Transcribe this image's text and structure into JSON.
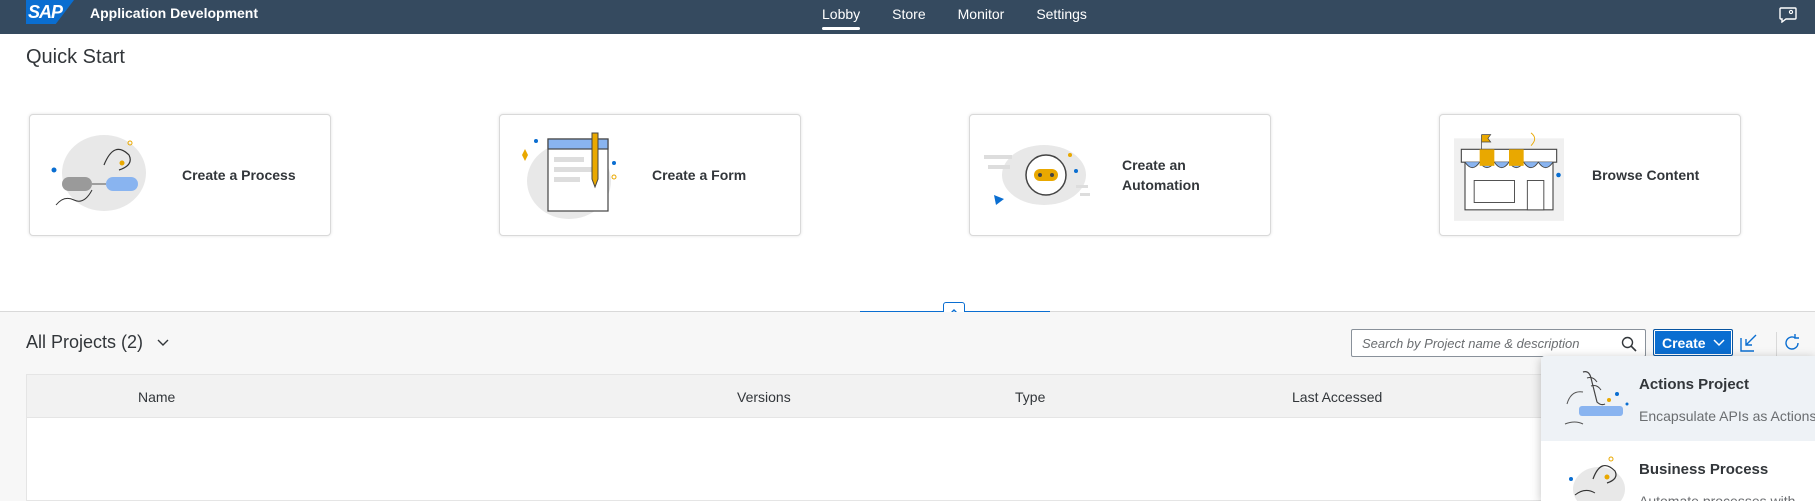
{
  "shell": {
    "logo": "SAP",
    "app_title": "Application Development",
    "nav": [
      "Lobby",
      "Store",
      "Monitor",
      "Settings"
    ],
    "active_nav": "Lobby",
    "accent_color": "#354a5f"
  },
  "quick_start": {
    "title": "Quick Start",
    "cards": [
      {
        "label": "Create a Process",
        "icon": "process-illustration"
      },
      {
        "label": "Create a Form",
        "icon": "form-illustration"
      },
      {
        "label": "Create an Automation",
        "icon": "automation-robot-illustration"
      },
      {
        "label": "Browse Content",
        "icon": "store-illustration"
      }
    ]
  },
  "projects": {
    "title": "All Projects (2)",
    "search_placeholder": "Search by Project name & description",
    "create_label": "Create",
    "columns": [
      "Name",
      "Versions",
      "Type",
      "Last Accessed"
    ]
  },
  "create_menu": {
    "items": [
      {
        "title": "Actions Project",
        "description": "Encapsulate APIs as Actions"
      },
      {
        "title": "Business Process",
        "description": "Automate processes with"
      }
    ]
  }
}
